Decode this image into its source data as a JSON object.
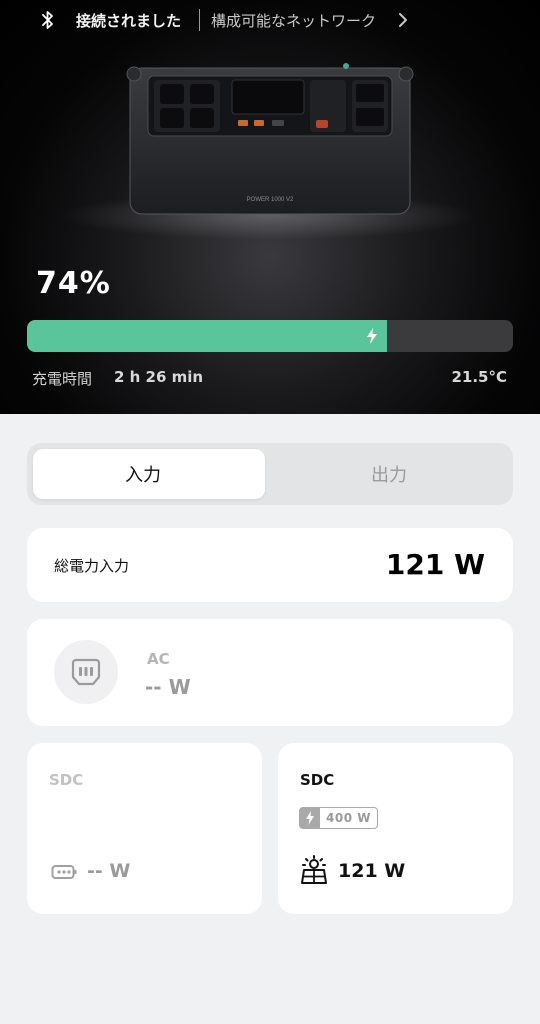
{
  "header": {
    "bluetooth_icon": "bluetooth-icon",
    "connection_status": "接続されました",
    "networks_link": "構成可能なネットワーク",
    "chevron_icon": "chevron-right-icon"
  },
  "device": {
    "model_label": "POWER 1000 V2"
  },
  "battery": {
    "percent_text": "74%",
    "percent_value": 74,
    "charge_label": "充電時間",
    "charge_time": "2 h 26 min",
    "temperature": "21.5°C",
    "bar_color": "#5ac49a"
  },
  "tabs": {
    "input_label": "入力",
    "output_label": "出力",
    "active": "input"
  },
  "total": {
    "label": "総電力入力",
    "value": "121 W"
  },
  "ac": {
    "icon": "ac-plug-icon",
    "title": "AC",
    "value": "-- W"
  },
  "sdc_left": {
    "title": "SDC",
    "icon": "dc-port-icon",
    "value": "-- W"
  },
  "sdc_right": {
    "title": "SDC",
    "badge": "400 W",
    "icon": "solar-panel-icon",
    "value": "121 W"
  }
}
